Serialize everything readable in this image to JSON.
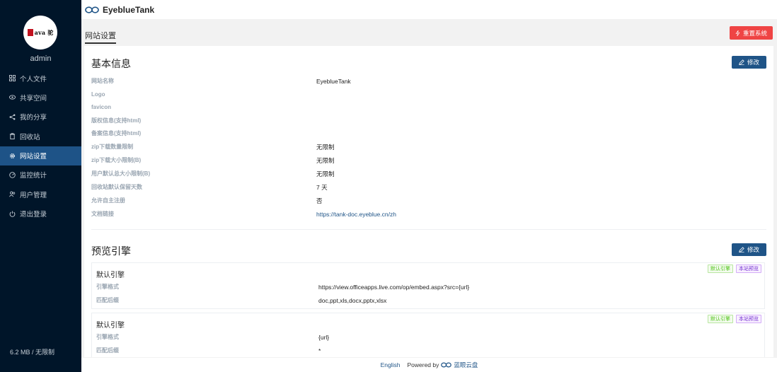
{
  "app": {
    "name": "EyeblueTank"
  },
  "sidebar": {
    "username": "admin",
    "avatar_text": "ava 驼",
    "items": [
      {
        "label": "个人文件",
        "icon": "grid-icon"
      },
      {
        "label": "共享空间",
        "icon": "eye-icon"
      },
      {
        "label": "我的分享",
        "icon": "share-icon"
      },
      {
        "label": "回收站",
        "icon": "trash-icon"
      },
      {
        "label": "网站设置",
        "icon": "gear-icon",
        "active": true
      },
      {
        "label": "监控统计",
        "icon": "dashboard-icon"
      },
      {
        "label": "用户管理",
        "icon": "users-icon"
      },
      {
        "label": "退出登录",
        "icon": "power-icon"
      }
    ],
    "storage": "6.2 MB / 无限制"
  },
  "header": {
    "title": "网站设置",
    "reset_label": "重置系统"
  },
  "basic": {
    "title": "基本信息",
    "edit_label": "修改",
    "rows": [
      {
        "label": "网站名称",
        "value": "EyeblueTank"
      },
      {
        "label": "Logo",
        "value": ""
      },
      {
        "label": "favicon",
        "value": ""
      },
      {
        "label": "版权信息(支持html)",
        "value": ""
      },
      {
        "label": "备案信息(支持html)",
        "value": ""
      },
      {
        "label": "zip下载数量限制",
        "value": "无限制"
      },
      {
        "label": "zip下载大小限制(B)",
        "value": "无限制"
      },
      {
        "label": "用户默认总大小限制(B)",
        "value": "无限制"
      },
      {
        "label": "回收站默认保留天数",
        "value": "7 天"
      },
      {
        "label": "允许自主注册",
        "value": "否"
      },
      {
        "label": "文档链接",
        "value": "https://tank-doc.eyeblue.cn/zh"
      }
    ]
  },
  "preview": {
    "title": "预览引擎",
    "edit_label": "修改",
    "engines": [
      {
        "name": "默认引擎",
        "tag_default": "默认引擎",
        "tag_site": "本站预览",
        "format_label": "引擎格式",
        "format_value": "https://view.officeapps.live.com/op/embed.aspx?src={url}",
        "suffix_label": "匹配后缀",
        "suffix_value": "doc,ppt,xls,docx,pptx,xlsx"
      },
      {
        "name": "默认引擎",
        "tag_default": "默认引擎",
        "tag_site": "本站预览",
        "format_label": "引擎格式",
        "format_value": "{url}",
        "suffix_label": "匹配后缀",
        "suffix_value": "*"
      }
    ]
  },
  "footer": {
    "language": "English",
    "powered_by": "Powered by",
    "brand": "蓝眼云盘"
  },
  "colors": {
    "sidebar_bg": "#001529",
    "active_item": "#1e5387",
    "primary": "#1f5487",
    "danger": "#ef4444"
  }
}
